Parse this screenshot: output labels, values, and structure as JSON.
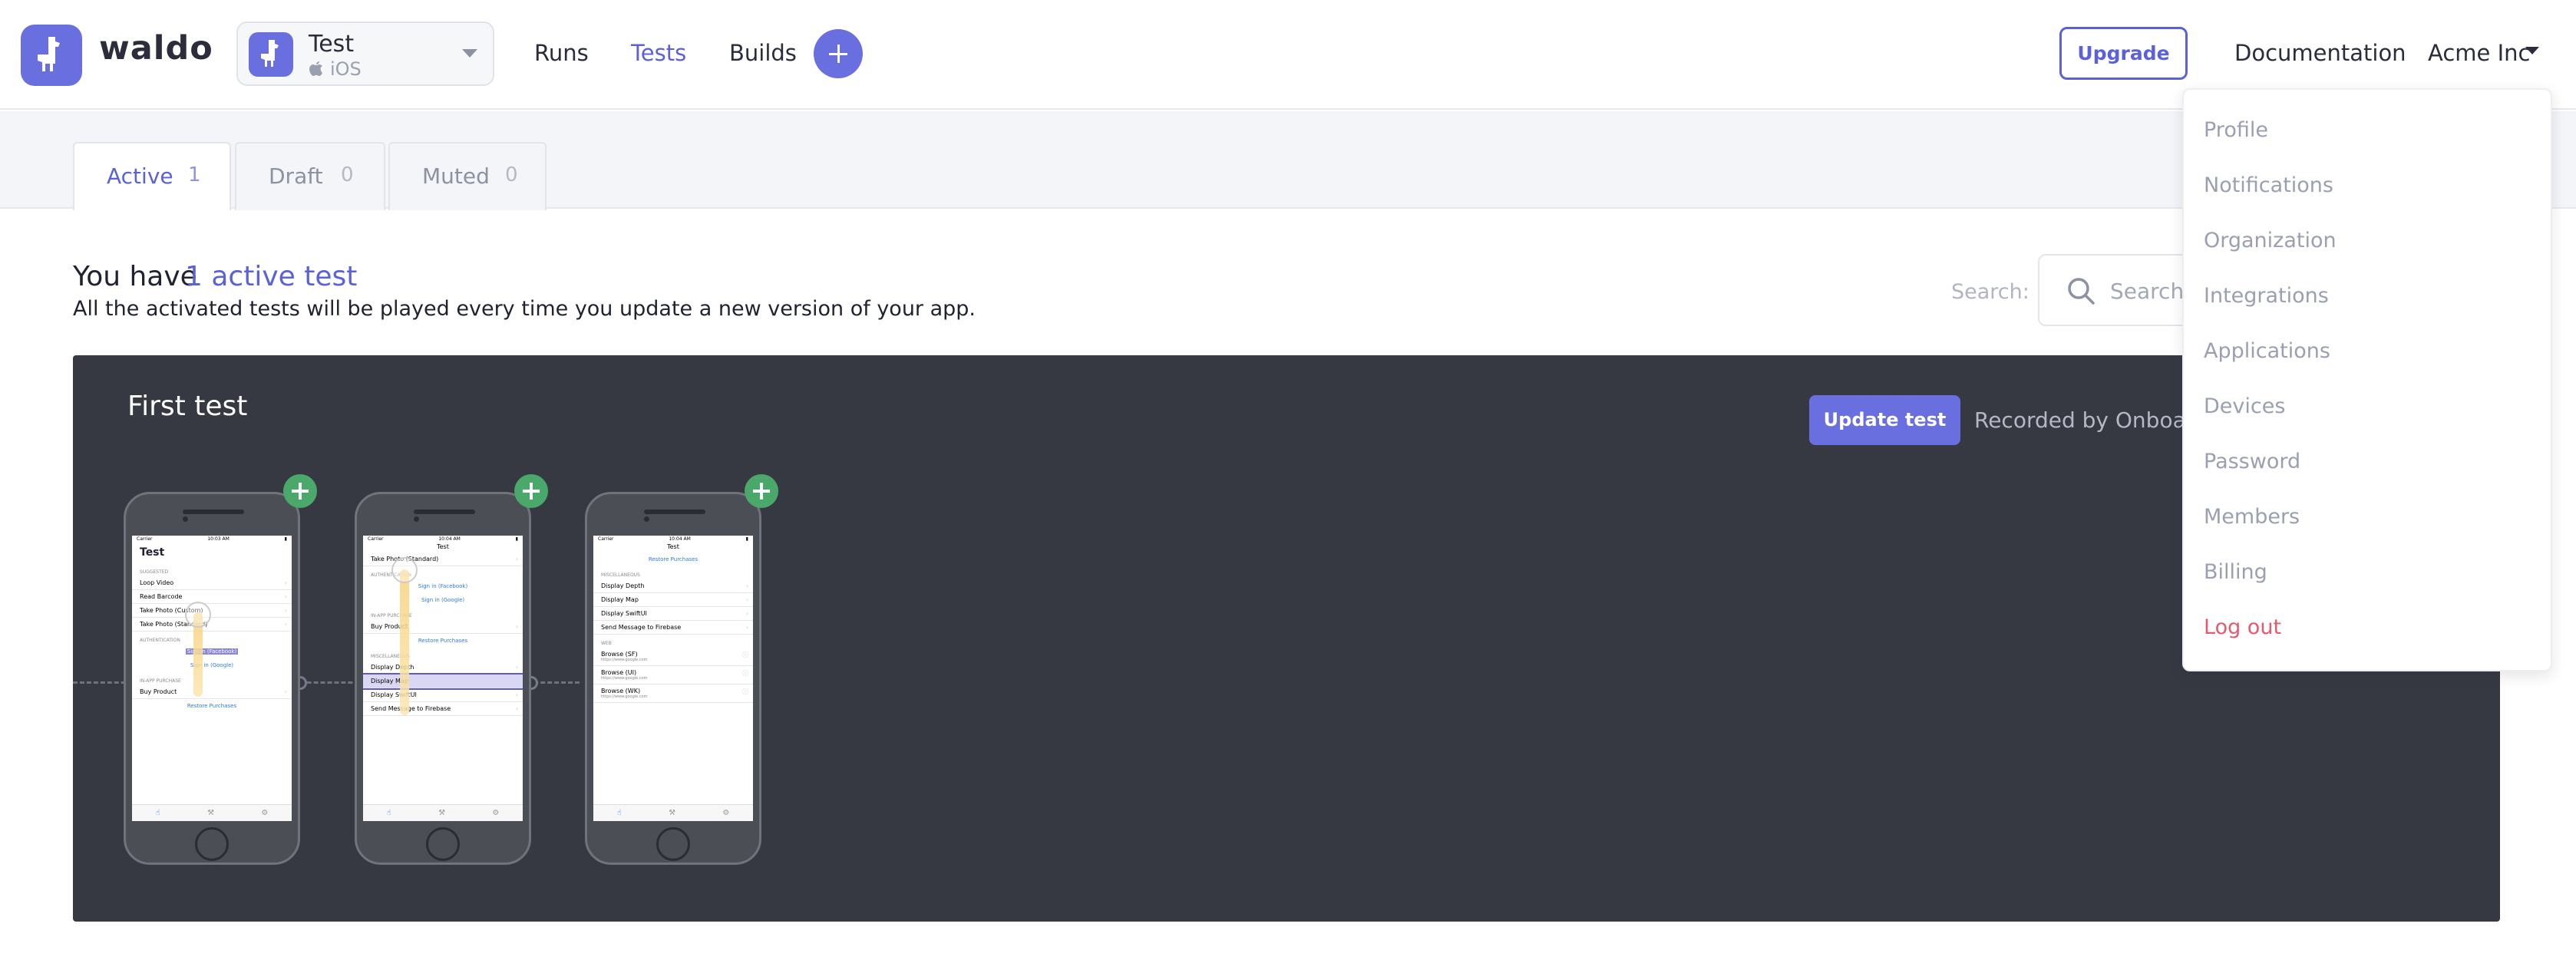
{
  "header": {
    "brand": "waldo",
    "app": {
      "name": "Test",
      "platform": "iOS"
    },
    "nav": [
      "Runs",
      "Tests",
      "Builds"
    ],
    "active_nav": "Tests",
    "upgrade_label": "Upgrade",
    "documentation_label": "Documentation",
    "account_label": "Acme Inc"
  },
  "tabs": [
    {
      "label": "Active",
      "count": "1"
    },
    {
      "label": "Draft",
      "count": "0"
    },
    {
      "label": "Muted",
      "count": "0"
    }
  ],
  "summary": {
    "prefix": "You have",
    "link": "1 active test",
    "subtitle": "All the activated tests will be played every time you update a new version of your app."
  },
  "search": {
    "label": "Search:",
    "placeholder": "Search t"
  },
  "test_card": {
    "title": "First test",
    "update_label": "Update test",
    "recorded_by": "Recorded by Onboardin"
  },
  "screens": {
    "s1": {
      "status_left": "Carrier",
      "status_time": "10:03 AM",
      "title": "Test",
      "sec_a": "SUGGESTED",
      "rows_a": [
        "Loop Video",
        "Read Barcode",
        "Take Photo (Custom)",
        "Take Photo (Standard)"
      ],
      "sec_b": "AUTHENTICATION",
      "hl": "Sign in (Facebook)",
      "link_b": "Sign in (Google)",
      "sec_c": "IN-APP PURCHASE",
      "row_c": "Buy Product",
      "link_c": "Restore Purchases"
    },
    "s2": {
      "status_left": "Carrier",
      "status_time": "10:04 AM",
      "nav_title": "Test",
      "top_row": "Take Photo (Standard)",
      "sec_a": "AUTHENTICATION",
      "link_a1": "Sign in (Facebook)",
      "link_a2": "Sign in (Google)",
      "sec_b": "IN-APP PURCHASE",
      "row_b": "Buy Product",
      "link_b": "Restore Purchases",
      "sec_c": "MISCELLANEOUS",
      "rows_c": [
        "Display Depth",
        "Display Map",
        "Display SwiftUI",
        "Send Message to Firebase"
      ]
    },
    "s3": {
      "status_left": "Carrier",
      "status_time": "10:04 AM",
      "nav_title": "Test",
      "link_top": "Restore Purchases",
      "sec_a": "MISCELLANEOUS",
      "rows_a": [
        "Display Depth",
        "Display Map",
        "Display SwiftUI",
        "Send Message to Firebase"
      ],
      "sec_b": "WEB",
      "web_rows": [
        {
          "label": "Browse (SF)",
          "url": "https://www.google.com"
        },
        {
          "label": "Browse (UI)",
          "url": "https://www.google.com"
        },
        {
          "label": "Browse (WK)",
          "url": "https://www.google.com"
        }
      ]
    }
  },
  "account_menu": [
    "Profile",
    "Notifications",
    "Organization",
    "Integrations",
    "Applications",
    "Devices",
    "Password",
    "Members",
    "Billing",
    "Log out"
  ],
  "colors": {
    "accent": "#5b61d9",
    "card": "#363942",
    "add_badge": "#49a86a",
    "logout": "#e45a6e"
  }
}
